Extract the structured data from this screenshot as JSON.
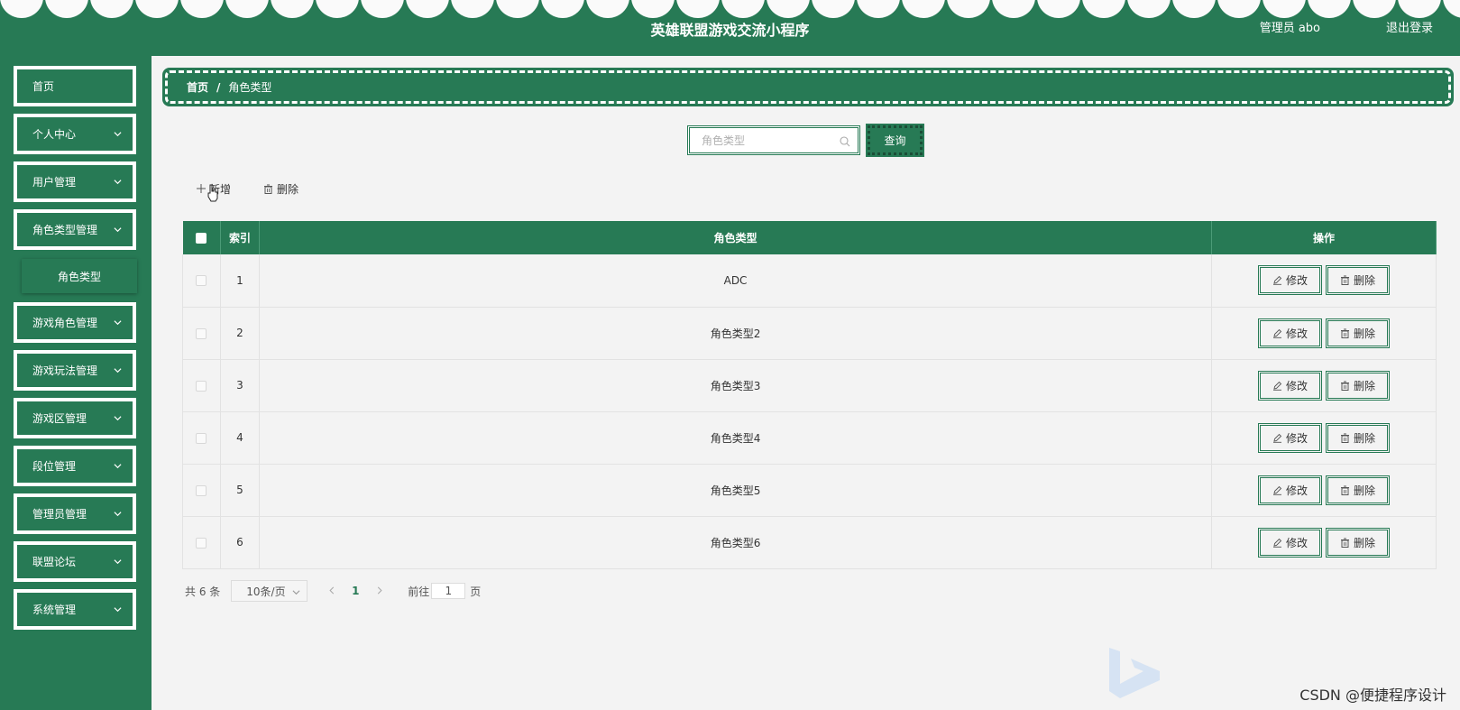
{
  "header": {
    "title": "英雄联盟游戏交流小程序",
    "user": "管理员 abo",
    "logout": "退出登录"
  },
  "sidebar": {
    "items": [
      {
        "label": "首页",
        "chevron": false
      },
      {
        "label": "个人中心",
        "chevron": true
      },
      {
        "label": "用户管理",
        "chevron": true
      },
      {
        "label": "角色类型管理",
        "chevron": true
      },
      {
        "label": "游戏角色管理",
        "chevron": true
      },
      {
        "label": "游戏玩法管理",
        "chevron": true
      },
      {
        "label": "游戏区管理",
        "chevron": true
      },
      {
        "label": "段位管理",
        "chevron": true
      },
      {
        "label": "管理员管理",
        "chevron": true
      },
      {
        "label": "联盟论坛",
        "chevron": true
      },
      {
        "label": "系统管理",
        "chevron": true
      }
    ],
    "submenu": {
      "label": "角色类型"
    }
  },
  "breadcrumb": {
    "home": "首页",
    "separator": "/",
    "current": "角色类型"
  },
  "search": {
    "placeholder": "角色类型",
    "value": "",
    "button": "查询"
  },
  "actions": {
    "add": "新增",
    "delete": "删除"
  },
  "table": {
    "headers": {
      "index": "索引",
      "type": "角色类型",
      "ops": "操作"
    },
    "rows": [
      {
        "index": "1",
        "type": "ADC"
      },
      {
        "index": "2",
        "type": "角色类型2"
      },
      {
        "index": "3",
        "type": "角色类型3"
      },
      {
        "index": "4",
        "type": "角色类型4"
      },
      {
        "index": "5",
        "type": "角色类型5"
      },
      {
        "index": "6",
        "type": "角色类型6"
      }
    ],
    "edit_label": "修改",
    "delete_label": "删除"
  },
  "pagination": {
    "total": "共 6 条",
    "page_size": "10条/页",
    "current_page": "1",
    "goto_label": "前往",
    "goto_value": "1",
    "unit": "页"
  },
  "watermark": "CSDN @便捷程序设计",
  "colors": {
    "primary": "#277a55",
    "background": "#f3f3f3"
  }
}
